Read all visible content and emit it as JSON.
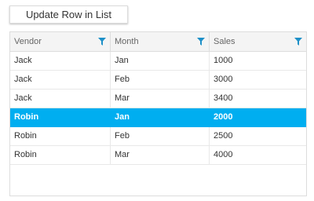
{
  "toolbar": {
    "update_label": "Update Row in List"
  },
  "grid": {
    "columns": [
      {
        "label": "Vendor",
        "filter_icon": "filter-icon"
      },
      {
        "label": "Month",
        "filter_icon": "filter-icon"
      },
      {
        "label": "Sales",
        "filter_icon": "filter-icon"
      }
    ],
    "rows": [
      {
        "vendor": "Jack",
        "month": "Jan",
        "sales": "1000"
      },
      {
        "vendor": "Jack",
        "month": "Feb",
        "sales": "3000"
      },
      {
        "vendor": "Jack",
        "month": "Mar",
        "sales": "3400"
      },
      {
        "vendor": "Robin",
        "month": "Jan",
        "sales": "2000"
      },
      {
        "vendor": "Robin",
        "month": "Feb",
        "sales": "2500"
      },
      {
        "vendor": "Robin",
        "month": "Mar",
        "sales": "4000"
      }
    ],
    "selected_row_index": 3
  },
  "colors": {
    "selection": "#00aef0",
    "filter_icon": "#1e90c8",
    "header_bg": "#f4f4f4"
  }
}
